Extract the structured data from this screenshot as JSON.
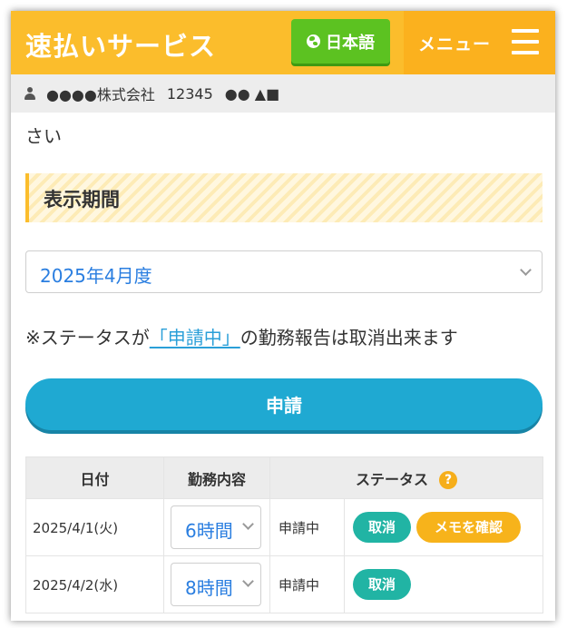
{
  "header": {
    "brand": "速払いサービス",
    "language_label": "日本語",
    "menu_label": "メニュー"
  },
  "userbar": {
    "company": "●●●●株式会社",
    "user_id": "12345",
    "user_name": "●● ▲■"
  },
  "content": {
    "cut_text": "さい",
    "section_title": "表示期間",
    "period_value": "2025年4月度",
    "notice_prefix": "※ステータスが",
    "notice_link": "「申請中」",
    "notice_suffix": "の勤務報告は取消出来ます",
    "apply_button": "申請"
  },
  "table": {
    "headers": {
      "date": "日付",
      "work": "勤務内容",
      "status": "ステータス"
    },
    "help_icon_glyph": "?",
    "rows": [
      {
        "date": "2025/4/1(火)",
        "hours": "6時間",
        "status": "申請中",
        "cancel": "取消",
        "memo": "メモを確認"
      },
      {
        "date": "2025/4/2(水)",
        "hours": "8時間",
        "status": "申請中",
        "cancel": "取消"
      }
    ]
  },
  "colors": {
    "header_bg": "#fbbd2c",
    "menu_bg": "#fbb11e",
    "language_button": "#5cc221",
    "apply_button": "#1fa9d2",
    "cancel_pill": "#21b4a4",
    "memo_pill": "#f7b31b",
    "link": "#2a9fd8"
  },
  "icons": [
    "user-icon",
    "globe-icon",
    "hamburger-icon",
    "chevron-down-icon",
    "help-icon"
  ]
}
